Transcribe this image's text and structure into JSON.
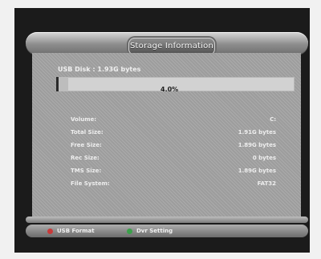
{
  "header": {
    "title": "Storage Information"
  },
  "usb": {
    "disk_label": "USB Disk : 1.93G bytes",
    "used_percent_text": "4.0%",
    "used_fraction": 0.04
  },
  "details": [
    {
      "label": "Volume:",
      "value": "C:"
    },
    {
      "label": "Total Size:",
      "value": "1.91G bytes"
    },
    {
      "label": "Free Size:",
      "value": "1.89G bytes"
    },
    {
      "label": "Rec Size:",
      "value": "0 bytes"
    },
    {
      "label": "TMS Size:",
      "value": "1.89G bytes"
    },
    {
      "label": "File System:",
      "value": "FAT32"
    }
  ],
  "footer": {
    "keys": [
      {
        "color": "#c83a3a",
        "label": "USB Format"
      },
      {
        "color": "#3aa04a",
        "label": "Dvr Setting"
      }
    ]
  }
}
